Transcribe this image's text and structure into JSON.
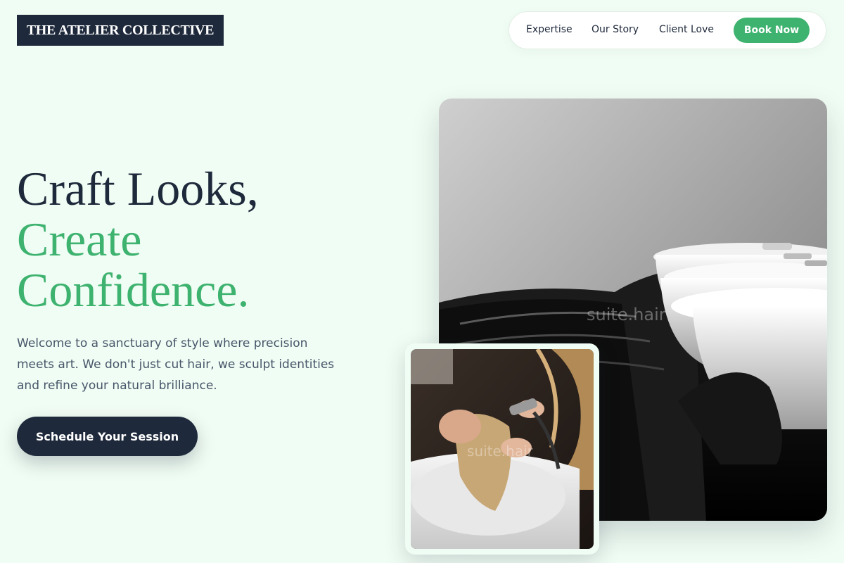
{
  "brand": {
    "name": "THE ATELIER COLLECTIVE"
  },
  "nav": {
    "items": [
      "Expertise",
      "Our Story",
      "Client Love"
    ],
    "cta_label": "Book Now"
  },
  "hero": {
    "title_line1": "Craft Looks,",
    "title_line2": "Create",
    "title_line3": "Confidence.",
    "description": "Welcome to a sanctuary of style where precision meets art. We don't just cut hair, we sculpt identities and refine your natural brilliance.",
    "cta_label": "Schedule Your Session"
  },
  "images": {
    "main_alt": "Row of salon shampoo basins",
    "main_watermark": "suite.hair",
    "small_alt": "Stylist washing client's hair",
    "small_watermark": "suite.hair"
  },
  "colors": {
    "background": "#f0fdf4",
    "navy": "#1e293b",
    "accent": "#3eb26f"
  }
}
